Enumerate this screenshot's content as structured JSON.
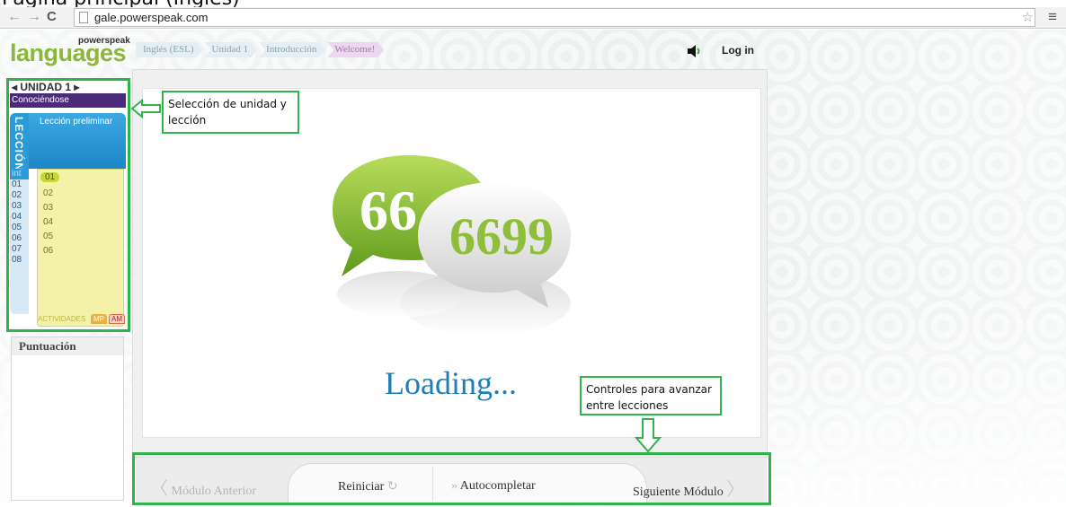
{
  "caption": {
    "text": "Página principal (Inglés)"
  },
  "browser": {
    "url": "gale.powerspeak.com",
    "icons": [
      "back-arrow-icon",
      "forward-arrow-icon",
      "reload-icon",
      "page-icon",
      "star-icon",
      "menu-icon"
    ]
  },
  "logo": {
    "small": "powerspeak",
    "big": "languages"
  },
  "breadcrumb": {
    "items": [
      {
        "label": "Inglés (ESL)"
      },
      {
        "label": "Unidad 1"
      },
      {
        "label": "Introducción"
      },
      {
        "label": "Welcome!"
      }
    ]
  },
  "header": {
    "login": "Log in"
  },
  "sidebar": {
    "unit_label": "◂ UNIDAD   1 ▸",
    "unit_name": "Conociéndose",
    "lesson_tab": "LECCIÓN",
    "lesson_title": "Lección preliminar",
    "side_numbers": [
      "int",
      "01",
      "02",
      "03",
      "04",
      "05",
      "06",
      "07",
      "08"
    ],
    "lessons": [
      "01",
      "02",
      "03",
      "04",
      "05",
      "06"
    ],
    "activities": {
      "label": "ACTIVIDADES",
      "mp": "MP",
      "am": "AM"
    }
  },
  "score": {
    "title": "Puntuación"
  },
  "main": {
    "loading": "Loading..."
  },
  "annotations": {
    "unit_selection": "Selección de unidad y lección",
    "controls": "Controles para avanzar entre lecciones"
  },
  "controls": {
    "prev": "Módulo Anterior",
    "reset": "Reiniciar",
    "autocomplete": "Autocompletar",
    "next": "Siguiente Módulo"
  },
  "colors": {
    "annotation_green": "#2fb34a",
    "logo_green": "#8cb63c",
    "unit_purple": "#4b2a7a",
    "lesson_blue": "#2a9ad8",
    "lesson_yellow": "#f3f2a8",
    "loading_blue": "#1d7fb3"
  }
}
